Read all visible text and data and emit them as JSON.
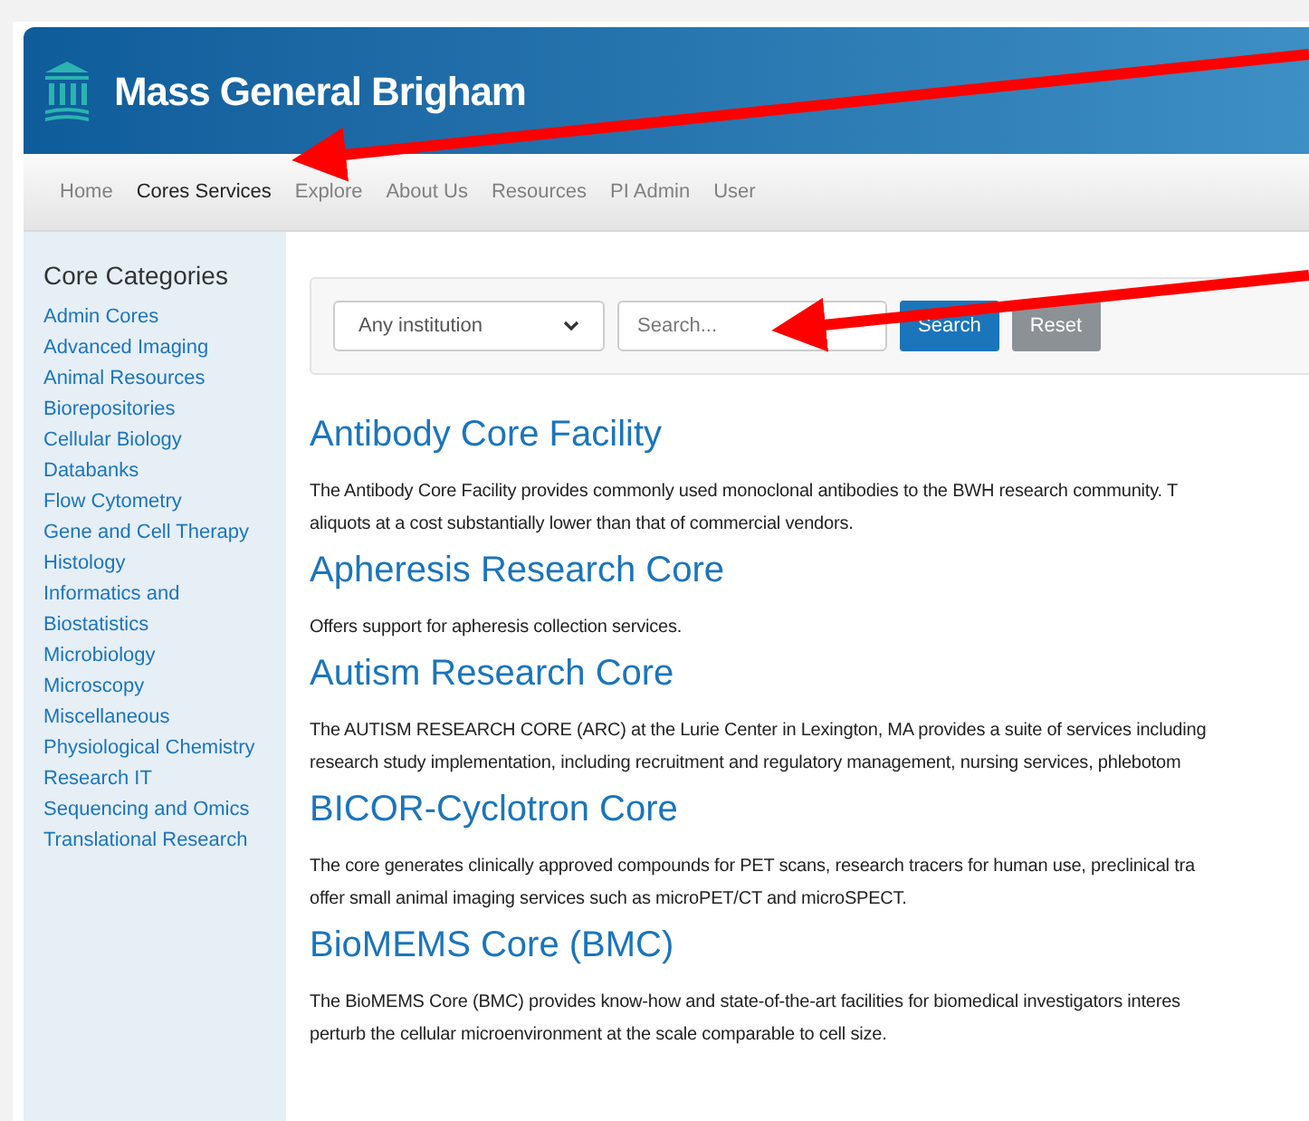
{
  "brand": {
    "name": "Mass General Brigham"
  },
  "nav": [
    {
      "label": "Home",
      "selected": false
    },
    {
      "label": "Cores Services",
      "selected": true
    },
    {
      "label": "Explore",
      "selected": false
    },
    {
      "label": "About Us",
      "selected": false
    },
    {
      "label": "Resources",
      "selected": false
    },
    {
      "label": "PI Admin",
      "selected": false
    },
    {
      "label": "User",
      "selected": false
    }
  ],
  "sidebar": {
    "title": "Core Categories",
    "items": [
      "Admin Cores",
      "Advanced Imaging",
      "Animal Resources",
      "Biorepositories",
      "Cellular Biology",
      "Databanks",
      "Flow Cytometry",
      "Gene and Cell Therapy",
      "Histology",
      "Informatics and",
      "Biostatistics",
      "Microbiology",
      "Microscopy",
      "Miscellaneous",
      "Physiological Chemistry",
      "Research IT",
      "Sequencing and Omics",
      "Translational Research"
    ]
  },
  "filters": {
    "institution": "Any institution",
    "search_placeholder": "Search...",
    "buttons": [
      "Search",
      "Reset"
    ]
  },
  "cores": [
    {
      "title": "Antibody Core Facility",
      "description": "The Antibody Core Facility provides commonly used monoclonal antibodies to the BWH research community. T\naliquots at a cost substantially lower than that of commercial vendors."
    },
    {
      "title": "Apheresis Research Core",
      "description": "Offers support for apheresis collection services."
    },
    {
      "title": "Autism Research Core",
      "description": "The AUTISM RESEARCH CORE (ARC) at the Lurie Center in Lexington, MA provides a suite of services including\nresearch study implementation, including recruitment and regulatory management, nursing services, phlebotom"
    },
    {
      "title": "BICOR-Cyclotron Core",
      "description": "The core generates clinically approved compounds for PET scans, research tracers for human use, preclinical tra\noffer small animal imaging services such as microPET/CT and microSPECT."
    },
    {
      "title": "BioMEMS Core (BMC)",
      "description": "The BioMEMS Core (BMC) provides know-how and state-of-the-art facilities for biomedical investigators interes\nperturb the cellular microenvironment at the scale comparable to cell size."
    }
  ]
}
